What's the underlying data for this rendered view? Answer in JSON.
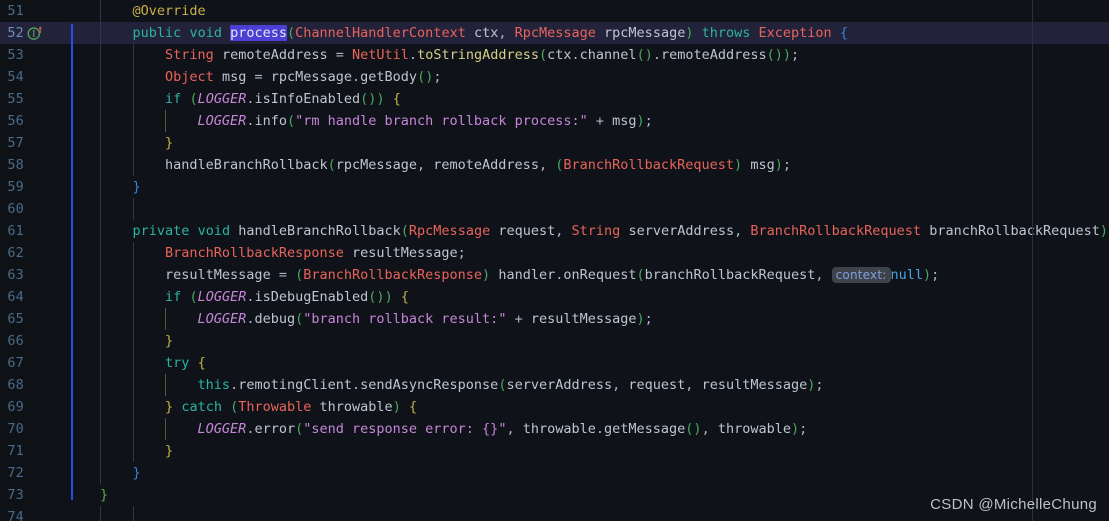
{
  "editor": {
    "theme_name": "darcula",
    "background_color": "#0f1218",
    "gutter_color": "#0e1116",
    "current_line_color": "#22223a",
    "selection_color": "#4c3fd4",
    "change_marker_color": "#2d49e8",
    "margin_guide_color": "#2a2f3a",
    "current_line_number": 52,
    "first_visible_line": 51,
    "last_visible_line": 74
  },
  "gutter": {
    "line_numbers": [
      "51",
      "52",
      "53",
      "54",
      "55",
      "56",
      "57",
      "58",
      "59",
      "60",
      "61",
      "62",
      "63",
      "64",
      "65",
      "66",
      "67",
      "68",
      "69",
      "70",
      "71",
      "72",
      "73",
      "74"
    ],
    "icons": [
      {
        "line": 51,
        "name": "intention-bulb-icon",
        "glyph": "bulb"
      },
      {
        "line": 52,
        "name": "implementing-method-icon",
        "glyph": "overridden-I"
      }
    ]
  },
  "selection": {
    "text": "process",
    "line": 52
  },
  "inlay_hints": [
    {
      "line": 63,
      "label": "context:"
    }
  ],
  "watermark": {
    "text": "CSDN @MichelleChung"
  },
  "code": {
    "lines": [
      {
        "n": 51,
        "tokens": [
          {
            "t": "    ",
            "c": "op"
          },
          {
            "t": "@Override",
            "c": "anno"
          }
        ]
      },
      {
        "n": 52,
        "current": true,
        "tokens": [
          {
            "t": "    ",
            "c": "op"
          },
          {
            "t": "public",
            "c": "kw"
          },
          {
            "t": " ",
            "c": "op"
          },
          {
            "t": "void",
            "c": "kw"
          },
          {
            "t": " ",
            "c": "op"
          },
          {
            "t": "process",
            "c": "fn",
            "sel": true
          },
          {
            "t": "(",
            "c": "paren"
          },
          {
            "t": "ChannelHandlerContext",
            "c": "typ"
          },
          {
            "t": " ",
            "c": "op"
          },
          {
            "t": "ctx",
            "c": "ident"
          },
          {
            "t": ", ",
            "c": "punc"
          },
          {
            "t": "RpcMessage",
            "c": "typ"
          },
          {
            "t": " ",
            "c": "op"
          },
          {
            "t": "rpcMessage",
            "c": "ident"
          },
          {
            "t": ")",
            "c": "paren"
          },
          {
            "t": " ",
            "c": "op"
          },
          {
            "t": "throws",
            "c": "kw"
          },
          {
            "t": " ",
            "c": "op"
          },
          {
            "t": "Exception",
            "c": "typ"
          },
          {
            "t": " ",
            "c": "op"
          },
          {
            "t": "{",
            "c": "parenB"
          }
        ]
      },
      {
        "n": 53,
        "tokens": [
          {
            "t": "        ",
            "c": "op"
          },
          {
            "t": "String",
            "c": "typ"
          },
          {
            "t": " ",
            "c": "op"
          },
          {
            "t": "remoteAddress",
            "c": "ident"
          },
          {
            "t": " = ",
            "c": "op"
          },
          {
            "t": "NetUtil",
            "c": "typ"
          },
          {
            "t": ".",
            "c": "punc"
          },
          {
            "t": "toStringAddress",
            "c": "fn"
          },
          {
            "t": "(",
            "c": "paren"
          },
          {
            "t": "ctx",
            "c": "ident"
          },
          {
            "t": ".",
            "c": "punc"
          },
          {
            "t": "channel",
            "c": "call"
          },
          {
            "t": "()",
            "c": "paren"
          },
          {
            "t": ".",
            "c": "punc"
          },
          {
            "t": "remoteAddress",
            "c": "call"
          },
          {
            "t": "()",
            "c": "paren"
          },
          {
            "t": ")",
            "c": "paren"
          },
          {
            "t": ";",
            "c": "punc"
          }
        ]
      },
      {
        "n": 54,
        "tokens": [
          {
            "t": "        ",
            "c": "op"
          },
          {
            "t": "Object",
            "c": "typ"
          },
          {
            "t": " ",
            "c": "op"
          },
          {
            "t": "msg",
            "c": "ident"
          },
          {
            "t": " = ",
            "c": "op"
          },
          {
            "t": "rpcMessage",
            "c": "ident"
          },
          {
            "t": ".",
            "c": "punc"
          },
          {
            "t": "getBody",
            "c": "call"
          },
          {
            "t": "()",
            "c": "paren"
          },
          {
            "t": ";",
            "c": "punc"
          }
        ]
      },
      {
        "n": 55,
        "tokens": [
          {
            "t": "        ",
            "c": "op"
          },
          {
            "t": "if",
            "c": "kw"
          },
          {
            "t": " ",
            "c": "op"
          },
          {
            "t": "(",
            "c": "paren"
          },
          {
            "t": "LOGGER",
            "c": "stat"
          },
          {
            "t": ".",
            "c": "punc"
          },
          {
            "t": "isInfoEnabled",
            "c": "call"
          },
          {
            "t": "()",
            "c": "paren"
          },
          {
            "t": ")",
            "c": "paren"
          },
          {
            "t": " ",
            "c": "op"
          },
          {
            "t": "{",
            "c": "parenY"
          }
        ]
      },
      {
        "n": 56,
        "tokens": [
          {
            "t": "            ",
            "c": "op"
          },
          {
            "t": "LOGGER",
            "c": "stat"
          },
          {
            "t": ".",
            "c": "punc"
          },
          {
            "t": "info",
            "c": "call"
          },
          {
            "t": "(",
            "c": "paren"
          },
          {
            "t": "\"rm handle branch rollback process:\"",
            "c": "str"
          },
          {
            "t": " + ",
            "c": "op"
          },
          {
            "t": "msg",
            "c": "ident"
          },
          {
            "t": ")",
            "c": "paren"
          },
          {
            "t": ";",
            "c": "punc"
          }
        ]
      },
      {
        "n": 57,
        "tokens": [
          {
            "t": "        ",
            "c": "op"
          },
          {
            "t": "}",
            "c": "parenY"
          }
        ]
      },
      {
        "n": 58,
        "tokens": [
          {
            "t": "        ",
            "c": "op"
          },
          {
            "t": "handleBranchRollback",
            "c": "call"
          },
          {
            "t": "(",
            "c": "paren"
          },
          {
            "t": "rpcMessage",
            "c": "ident"
          },
          {
            "t": ", ",
            "c": "punc"
          },
          {
            "t": "remoteAddress",
            "c": "ident"
          },
          {
            "t": ", ",
            "c": "punc"
          },
          {
            "t": "(",
            "c": "paren"
          },
          {
            "t": "BranchRollbackRequest",
            "c": "typ"
          },
          {
            "t": ")",
            "c": "paren"
          },
          {
            "t": " ",
            "c": "op"
          },
          {
            "t": "msg",
            "c": "ident"
          },
          {
            "t": ")",
            "c": "paren"
          },
          {
            "t": ";",
            "c": "punc"
          }
        ]
      },
      {
        "n": 59,
        "tokens": [
          {
            "t": "    ",
            "c": "op"
          },
          {
            "t": "}",
            "c": "parenB"
          }
        ]
      },
      {
        "n": 60,
        "tokens": []
      },
      {
        "n": 61,
        "tokens": [
          {
            "t": "    ",
            "c": "op"
          },
          {
            "t": "private",
            "c": "kw"
          },
          {
            "t": " ",
            "c": "op"
          },
          {
            "t": "void",
            "c": "kw"
          },
          {
            "t": " ",
            "c": "op"
          },
          {
            "t": "handleBranchRollback",
            "c": "call"
          },
          {
            "t": "(",
            "c": "paren"
          },
          {
            "t": "RpcMessage",
            "c": "typ"
          },
          {
            "t": " ",
            "c": "op"
          },
          {
            "t": "request",
            "c": "ident"
          },
          {
            "t": ", ",
            "c": "punc"
          },
          {
            "t": "String",
            "c": "typ"
          },
          {
            "t": " ",
            "c": "op"
          },
          {
            "t": "serverAddress",
            "c": "ident"
          },
          {
            "t": ", ",
            "c": "punc"
          },
          {
            "t": "BranchRollbackRequest",
            "c": "typ"
          },
          {
            "t": " ",
            "c": "op"
          },
          {
            "t": "branchRollbackRequest",
            "c": "ident"
          },
          {
            "t": ")",
            "c": "paren"
          },
          {
            "t": " ",
            "c": "op"
          },
          {
            "t": "{",
            "c": "parenB"
          }
        ]
      },
      {
        "n": 62,
        "tokens": [
          {
            "t": "        ",
            "c": "op"
          },
          {
            "t": "BranchRollbackResponse",
            "c": "typ"
          },
          {
            "t": " ",
            "c": "op"
          },
          {
            "t": "resultMessage",
            "c": "ident"
          },
          {
            "t": ";",
            "c": "punc"
          }
        ]
      },
      {
        "n": 63,
        "tokens": [
          {
            "t": "        ",
            "c": "op"
          },
          {
            "t": "resultMessage",
            "c": "ident"
          },
          {
            "t": " = ",
            "c": "op"
          },
          {
            "t": "(",
            "c": "paren"
          },
          {
            "t": "BranchRollbackResponse",
            "c": "typ"
          },
          {
            "t": ")",
            "c": "paren"
          },
          {
            "t": " ",
            "c": "op"
          },
          {
            "t": "handler",
            "c": "ident"
          },
          {
            "t": ".",
            "c": "punc"
          },
          {
            "t": "onRequest",
            "c": "call"
          },
          {
            "t": "(",
            "c": "paren"
          },
          {
            "t": "branchRollbackRequest",
            "c": "ident"
          },
          {
            "t": ", ",
            "c": "punc"
          },
          {
            "t": "context:",
            "c": "inlay",
            "inlay": true
          },
          {
            "t": "null",
            "c": "num"
          },
          {
            "t": ")",
            "c": "paren"
          },
          {
            "t": ";",
            "c": "punc"
          }
        ]
      },
      {
        "n": 64,
        "tokens": [
          {
            "t": "        ",
            "c": "op"
          },
          {
            "t": "if",
            "c": "kw"
          },
          {
            "t": " ",
            "c": "op"
          },
          {
            "t": "(",
            "c": "paren"
          },
          {
            "t": "LOGGER",
            "c": "stat"
          },
          {
            "t": ".",
            "c": "punc"
          },
          {
            "t": "isDebugEnabled",
            "c": "call"
          },
          {
            "t": "()",
            "c": "paren"
          },
          {
            "t": ")",
            "c": "paren"
          },
          {
            "t": " ",
            "c": "op"
          },
          {
            "t": "{",
            "c": "parenY"
          }
        ]
      },
      {
        "n": 65,
        "tokens": [
          {
            "t": "            ",
            "c": "op"
          },
          {
            "t": "LOGGER",
            "c": "stat"
          },
          {
            "t": ".",
            "c": "punc"
          },
          {
            "t": "debug",
            "c": "call"
          },
          {
            "t": "(",
            "c": "paren"
          },
          {
            "t": "\"branch rollback result:\"",
            "c": "str"
          },
          {
            "t": " + ",
            "c": "op"
          },
          {
            "t": "resultMessage",
            "c": "ident"
          },
          {
            "t": ")",
            "c": "paren"
          },
          {
            "t": ";",
            "c": "punc"
          }
        ]
      },
      {
        "n": 66,
        "tokens": [
          {
            "t": "        ",
            "c": "op"
          },
          {
            "t": "}",
            "c": "parenY"
          }
        ]
      },
      {
        "n": 67,
        "tokens": [
          {
            "t": "        ",
            "c": "op"
          },
          {
            "t": "try",
            "c": "kw"
          },
          {
            "t": " ",
            "c": "op"
          },
          {
            "t": "{",
            "c": "parenY"
          }
        ]
      },
      {
        "n": 68,
        "tokens": [
          {
            "t": "            ",
            "c": "op"
          },
          {
            "t": "this",
            "c": "kw"
          },
          {
            "t": ".",
            "c": "punc"
          },
          {
            "t": "remotingClient",
            "c": "ident"
          },
          {
            "t": ".",
            "c": "punc"
          },
          {
            "t": "sendAsyncResponse",
            "c": "call"
          },
          {
            "t": "(",
            "c": "paren"
          },
          {
            "t": "serverAddress",
            "c": "ident"
          },
          {
            "t": ", ",
            "c": "punc"
          },
          {
            "t": "request",
            "c": "ident"
          },
          {
            "t": ", ",
            "c": "punc"
          },
          {
            "t": "resultMessage",
            "c": "ident"
          },
          {
            "t": ")",
            "c": "paren"
          },
          {
            "t": ";",
            "c": "punc"
          }
        ]
      },
      {
        "n": 69,
        "tokens": [
          {
            "t": "        ",
            "c": "op"
          },
          {
            "t": "}",
            "c": "parenY"
          },
          {
            "t": " ",
            "c": "op"
          },
          {
            "t": "catch",
            "c": "kw"
          },
          {
            "t": " ",
            "c": "op"
          },
          {
            "t": "(",
            "c": "paren"
          },
          {
            "t": "Throwable",
            "c": "typ"
          },
          {
            "t": " ",
            "c": "op"
          },
          {
            "t": "throwable",
            "c": "ident"
          },
          {
            "t": ")",
            "c": "paren"
          },
          {
            "t": " ",
            "c": "op"
          },
          {
            "t": "{",
            "c": "parenY"
          }
        ]
      },
      {
        "n": 70,
        "tokens": [
          {
            "t": "            ",
            "c": "op"
          },
          {
            "t": "LOGGER",
            "c": "stat"
          },
          {
            "t": ".",
            "c": "punc"
          },
          {
            "t": "error",
            "c": "call"
          },
          {
            "t": "(",
            "c": "paren"
          },
          {
            "t": "\"send response error: {}\"",
            "c": "str"
          },
          {
            "t": ", ",
            "c": "punc"
          },
          {
            "t": "throwable",
            "c": "ident"
          },
          {
            "t": ".",
            "c": "punc"
          },
          {
            "t": "getMessage",
            "c": "call"
          },
          {
            "t": "()",
            "c": "paren"
          },
          {
            "t": ", ",
            "c": "punc"
          },
          {
            "t": "throwable",
            "c": "ident"
          },
          {
            "t": ")",
            "c": "paren"
          },
          {
            "t": ";",
            "c": "punc"
          }
        ]
      },
      {
        "n": 71,
        "tokens": [
          {
            "t": "        ",
            "c": "op"
          },
          {
            "t": "}",
            "c": "parenY"
          }
        ]
      },
      {
        "n": 72,
        "tokens": [
          {
            "t": "    ",
            "c": "op"
          },
          {
            "t": "}",
            "c": "parenB"
          }
        ]
      },
      {
        "n": 73,
        "tokens": [
          {
            "t": "",
            "c": "op"
          },
          {
            "t": "}",
            "c": "parenG"
          }
        ]
      },
      {
        "n": 74,
        "tokens": []
      }
    ]
  }
}
